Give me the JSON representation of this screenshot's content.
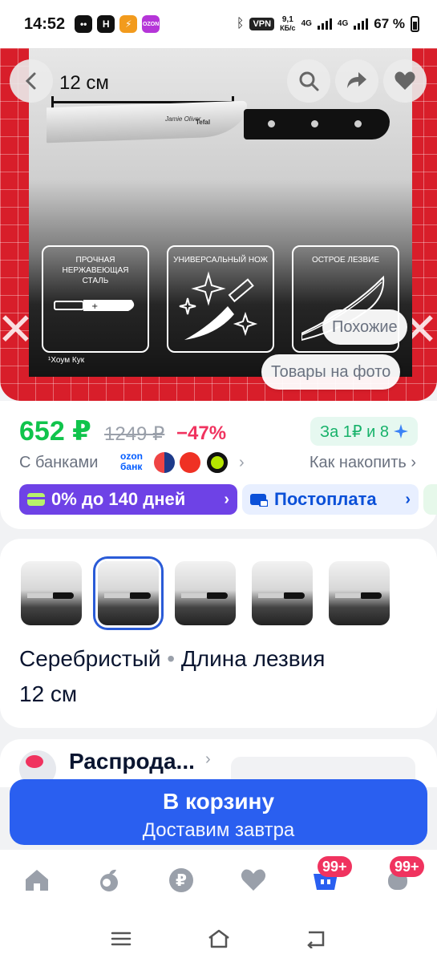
{
  "status_bar": {
    "time": "14:52",
    "apps": [
      {
        "name": "messenger-app-icon",
        "glyph": "••",
        "color": "#111111"
      },
      {
        "name": "h-app-icon",
        "glyph": "H",
        "color": "#111111"
      },
      {
        "name": "wb-app-icon",
        "glyph": "⚡",
        "color": "#f29b1d"
      },
      {
        "name": "ozon-app-icon",
        "glyph": "OZON",
        "color": "#b535d8"
      }
    ],
    "vpn": "VPN",
    "speed_value": "9,1",
    "speed_unit": "КБ/с",
    "network_1": "4G",
    "network_2": "4G",
    "battery": "67 %"
  },
  "hero": {
    "ruler_label": "12 см",
    "brand_1": "Jamie Oliver",
    "brand_2": "Tefal",
    "features": [
      "ПРОЧНАЯ НЕРЖАВЕЮЩАЯ СТАЛЬ",
      "УНИВЕРСАЛЬНЫЙ НОЖ",
      "ОСТРОЕ ЛЕЗВИЕ"
    ],
    "footnote": "¹Хоум Кук",
    "similar_label": "Похожие",
    "photo_items_label": "Товары на фото"
  },
  "price": {
    "current": "652 ₽",
    "old": "1249 ₽",
    "discount": "−47%",
    "bonus": "За 1₽ и 8",
    "with_banks": "С банками",
    "ozon_bank": "ozon банк",
    "how_to_save": "Как накопить",
    "installment": "0% до 140 дней",
    "postpay": "Постоплата"
  },
  "variant": {
    "color": "Серебристый",
    "separator": "•",
    "length_label": "Длина лезвия",
    "length_value": "12 см",
    "selected_index": 1
  },
  "sale": {
    "title": "Распрода..."
  },
  "cart": {
    "label": "В корзину",
    "delivery": "Доставим завтра"
  },
  "tabbar": {
    "cart_badge": "99+",
    "profile_badge": "99+"
  },
  "colors": {
    "accent_blue": "#2a5ff0",
    "price_green": "#10c44c",
    "discount_pink": "#f0335f",
    "installment_purple": "#6e42e6"
  }
}
